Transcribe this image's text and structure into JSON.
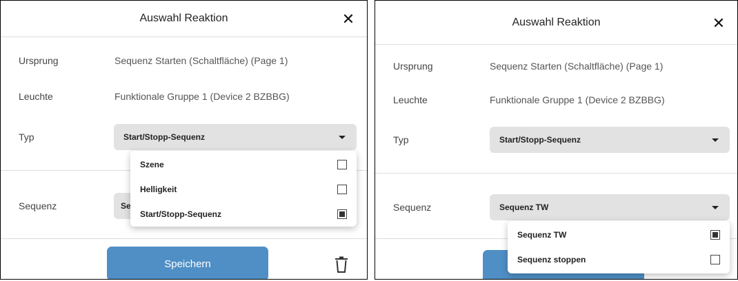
{
  "left": {
    "title": "Auswahl Reaktion",
    "close_glyph": "✕",
    "fields": {
      "ursprung_label": "Ursprung",
      "ursprung_value": "Sequenz Starten (Schaltfläche) (Page 1)",
      "leuchte_label": "Leuchte",
      "leuchte_value": "Funktionale Gruppe 1 (Device 2 BZBBG)",
      "typ_label": "Typ",
      "typ_selected": "Start/Stopp-Sequenz",
      "sequenz_label": "Sequenz",
      "sequenz_selected_partial": "Se"
    },
    "typ_menu": [
      {
        "label": "Szene",
        "checked": false
      },
      {
        "label": "Helligkeit",
        "checked": false
      },
      {
        "label": "Start/Stopp-Sequenz",
        "checked": true
      }
    ],
    "save_label": "Speichern"
  },
  "right": {
    "title": "Auswahl Reaktion",
    "close_glyph": "✕",
    "fields": {
      "ursprung_label": "Ursprung",
      "ursprung_value": "Sequenz Starten (Schaltfläche) (Page 1)",
      "leuchte_label": "Leuchte",
      "leuchte_value": "Funktionale Gruppe 1 (Device 2 BZBBG)",
      "typ_label": "Typ",
      "typ_selected": "Start/Stopp-Sequenz",
      "sequenz_label": "Sequenz",
      "sequenz_selected": "Sequenz TW"
    },
    "sequenz_menu": [
      {
        "label": "Sequenz TW",
        "checked": true
      },
      {
        "label": "Sequenz stoppen",
        "checked": false
      }
    ]
  },
  "colors": {
    "save_button": "#4f8fc6",
    "select_background": "#e2e2e2",
    "divider": "#dcdcdc"
  },
  "icons": [
    "close-icon",
    "chevron-down-icon",
    "checkbox-icon",
    "trash-icon"
  ]
}
